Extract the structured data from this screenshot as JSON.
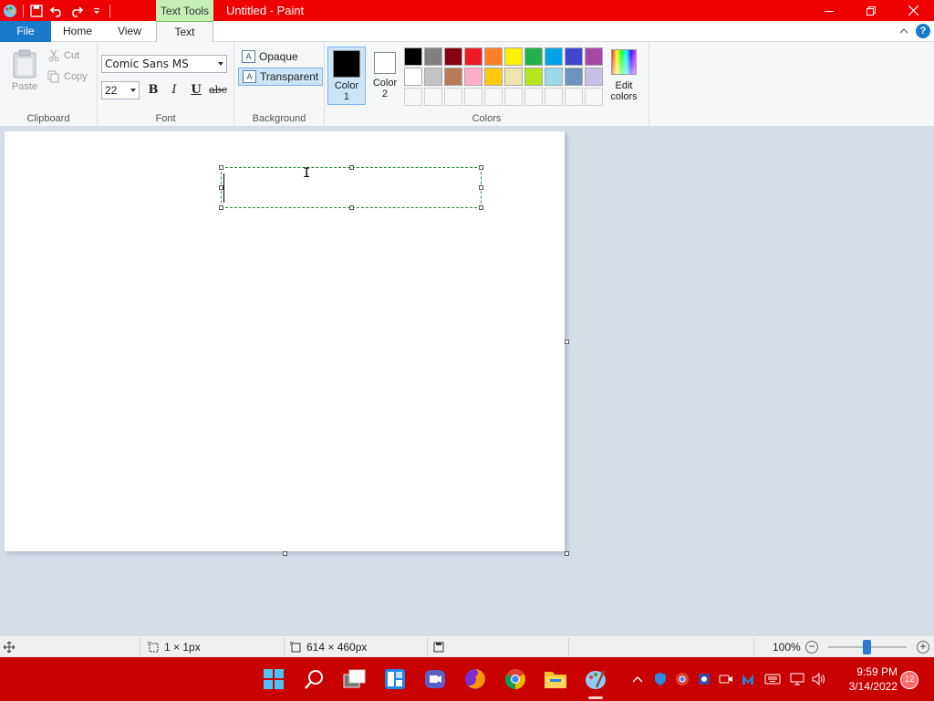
{
  "window": {
    "title": "Untitled - Paint",
    "context_tab_group": "Text Tools"
  },
  "ribbon_tabs": [
    "File",
    "Home",
    "View",
    "Text"
  ],
  "clipboard": {
    "paste_label": "Paste",
    "cut_label": "Cut",
    "copy_label": "Copy",
    "group_label": "Clipboard"
  },
  "font": {
    "family": "Comic Sans MS",
    "size": "22",
    "bold_label": "B",
    "italic_label": "I",
    "underline_label": "U",
    "strike_label": "abc",
    "group_label": "Font"
  },
  "background": {
    "opaque_label": "Opaque",
    "transparent_label": "Transparent",
    "selected": "Transparent",
    "group_label": "Background"
  },
  "colors": {
    "color1_label": "Color\n1",
    "color2_label": "Color\n2",
    "color1_value": "#000000",
    "color2_value": "#ffffff",
    "edit_label": "Edit\ncolors",
    "group_label": "Colors",
    "palette_row1": [
      "#000000",
      "#7f7f7f",
      "#880015",
      "#ed1c24",
      "#ff7f27",
      "#fff200",
      "#22b14c",
      "#00a2e8",
      "#3f48cc",
      "#a349a4"
    ],
    "palette_row2": [
      "#ffffff",
      "#c3c3c3",
      "#b97a57",
      "#ffaec9",
      "#ffc90e",
      "#efe4b0",
      "#b5e61d",
      "#99d9ea",
      "#7092be",
      "#c8bfe7"
    ]
  },
  "statusbar": {
    "selection_size": "1 × 1px",
    "canvas_size": "614 × 460px",
    "zoom": "100%"
  },
  "taskbar": {
    "time": "9:59 PM",
    "date": "3/14/2022",
    "notifications": "12"
  },
  "theme": {
    "titlebar": "#ef0000",
    "taskbar": "#c80000",
    "accent": "#1979ca"
  }
}
